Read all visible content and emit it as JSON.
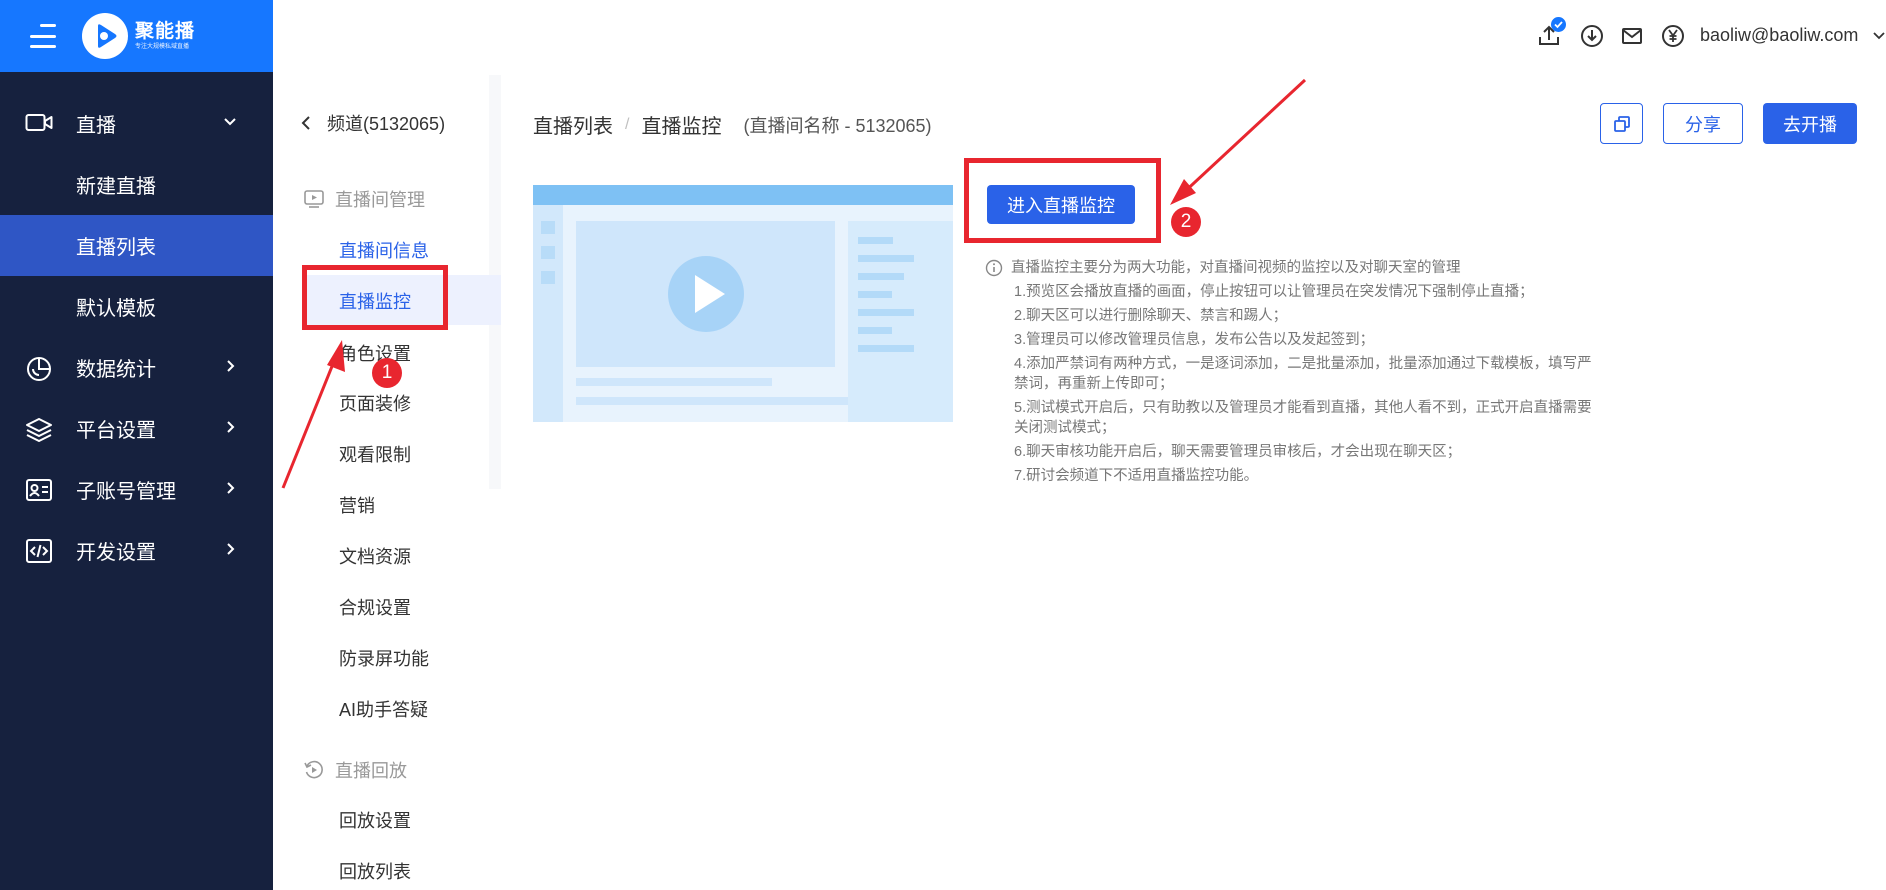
{
  "brand": {
    "name": "聚能播",
    "slogan": "专注大规模私域直播"
  },
  "nav": {
    "live": "直播",
    "new_live": "新建直播",
    "live_list": "直播列表",
    "default_template": "默认模板",
    "statistics": "数据统计",
    "platform_settings": "平台设置",
    "sub_accounts": "子账号管理",
    "dev_settings": "开发设置"
  },
  "header": {
    "account": "baoliw@baoliw.com"
  },
  "side2": {
    "back": "频道(5132065)",
    "group_room": "直播间管理",
    "items": [
      "直播间信息",
      "直播监控",
      "角色设置",
      "页面装修",
      "观看限制",
      "营销",
      "文档资源",
      "合规设置",
      "防录屏功能",
      "AI助手答疑"
    ],
    "group_replay": "直播回放",
    "replay_items": [
      "回放设置",
      "回放列表"
    ]
  },
  "breadcrumb": {
    "parent": "直播列表",
    "separator": "/",
    "current": "直播监控",
    "room": "(直播间名称 - 5132065)"
  },
  "actions": {
    "share": "分享",
    "go_live": "去开播",
    "enter_monitor": "进入直播监控"
  },
  "notes": {
    "head": "直播监控主要分为两大功能，对直播间视频的监控以及对聊天室的管理",
    "items": [
      "1.预览区会播放直播的画面，停止按钮可以让管理员在突发情况下强制停止直播；",
      "2.聊天区可以进行删除聊天、禁言和踢人；",
      "3.管理员可以修改管理员信息，发布公告以及发起签到；",
      "4.添加严禁词有两种方式，一是逐词添加，二是批量添加，批量添加通过下载模板，填写严禁词，再重新上传即可；",
      "5.测试模式开启后，只有助教以及管理员才能看到直播，其他人看不到，正式开启直播需要关闭测试模式；",
      "6.聊天审核功能开启后，聊天需要管理员审核后，才会出现在聊天区；",
      "7.研讨会频道下不适用直播监控功能。"
    ]
  },
  "annotations": {
    "marker1": "1",
    "marker2": "2"
  },
  "icons": {
    "menu": "menu-icon",
    "upload": "upload-icon",
    "download": "download-icon",
    "mail": "mail-icon",
    "yuan": "yuan-icon",
    "copy": "copy-icon",
    "video": "video-camera-icon",
    "stats": "pie-chart-icon",
    "layers": "layers-icon",
    "id_card": "id-card-icon",
    "code": "code-icon"
  },
  "colors": {
    "brand_blue": "#1677ff",
    "nav_bg": "#16213e",
    "nav_active": "#2f56c5",
    "primary": "#2a62e8",
    "annotation_red": "#e8262f"
  }
}
